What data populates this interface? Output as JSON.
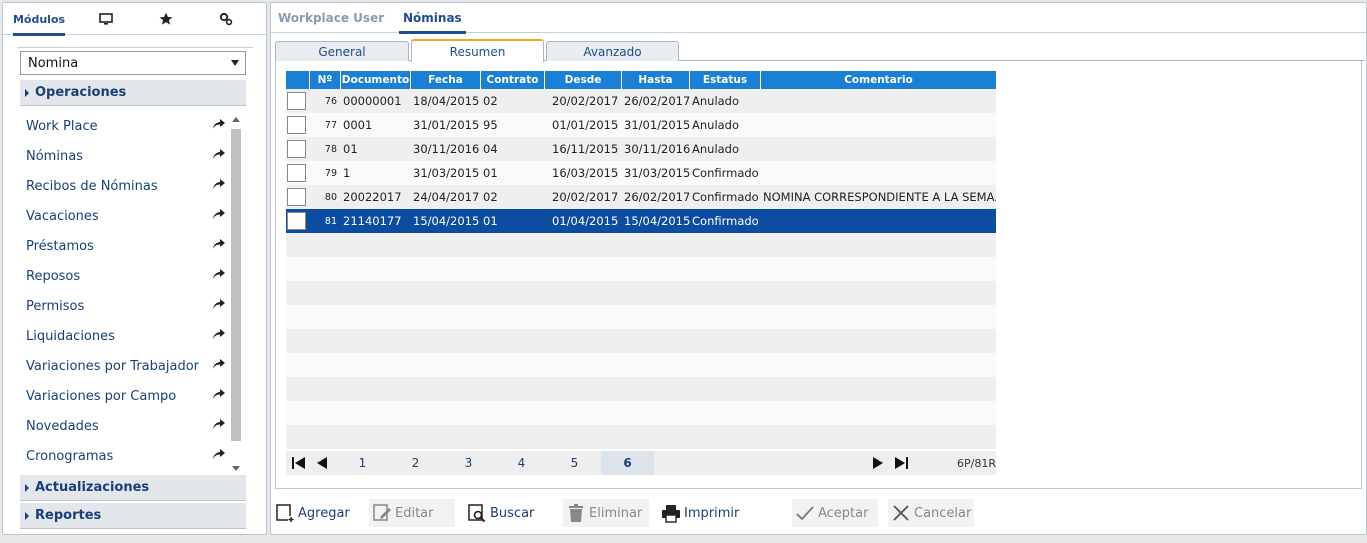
{
  "left_tabs": [
    {
      "label": "Módulos",
      "icon": null
    },
    {
      "label": "",
      "icon": "monitor-icon"
    },
    {
      "label": "",
      "icon": "star-icon"
    },
    {
      "label": "",
      "icon": "gear-settings-icon"
    }
  ],
  "module_select": {
    "value": "Nomina"
  },
  "sections": {
    "operaciones": "Operaciones",
    "actualizaciones": "Actualizaciones",
    "reportes": "Reportes"
  },
  "menu_items": [
    "Work Place",
    "Nóminas",
    "Recibos de Nóminas",
    "Vacaciones",
    "Préstamos",
    "Reposos",
    "Permisos",
    "Liquidaciones",
    "Variaciones por Trabajador",
    "Variaciones por Campo",
    "Novedades",
    "Cronogramas"
  ],
  "top_tabs": [
    "Workplace User",
    "Nóminas"
  ],
  "sub_tabs": [
    "General",
    "Resumen",
    "Avanzado"
  ],
  "grid": {
    "headers": [
      "Nº",
      "Documento",
      "Fecha",
      "Contrato",
      "Desde",
      "Hasta",
      "Estatus",
      "Comentario"
    ],
    "rows": [
      {
        "n": "76",
        "doc": "00000001",
        "fecha": "18/04/2015",
        "contrato": "02",
        "desde": "20/02/2017",
        "hasta": "26/02/2017",
        "estatus": "Anulado",
        "comentario": ""
      },
      {
        "n": "77",
        "doc": "0001",
        "fecha": "31/01/2015",
        "contrato": "95",
        "desde": "01/01/2015",
        "hasta": "31/01/2015",
        "estatus": "Anulado",
        "comentario": ""
      },
      {
        "n": "78",
        "doc": "01",
        "fecha": "30/11/2016",
        "contrato": "04",
        "desde": "16/11/2015",
        "hasta": "30/11/2016",
        "estatus": "Anulado",
        "comentario": ""
      },
      {
        "n": "79",
        "doc": "1",
        "fecha": "31/03/2015",
        "contrato": "01",
        "desde": "16/03/2015",
        "hasta": "31/03/2015",
        "estatus": "Confirmado",
        "comentario": ""
      },
      {
        "n": "80",
        "doc": "20022017",
        "fecha": "24/04/2017",
        "contrato": "02",
        "desde": "20/02/2017",
        "hasta": "26/02/2017",
        "estatus": "Confirmado",
        "comentario": "NOMINA CORRESPONDIENTE A LA SEMA..."
      },
      {
        "n": "81",
        "doc": "21140177",
        "fecha": "15/04/2015",
        "contrato": "01",
        "desde": "01/04/2015",
        "hasta": "15/04/2015",
        "estatus": "Confirmado",
        "comentario": ""
      }
    ],
    "selected_row": 5
  },
  "pager": {
    "pages": [
      "1",
      "2",
      "3",
      "4",
      "5",
      "6"
    ],
    "active_page": "6",
    "info": "6P/81R"
  },
  "toolbar": {
    "agregar": "Agregar",
    "editar": "Editar",
    "buscar": "Buscar",
    "eliminar": "Eliminar",
    "imprimir": "Imprimir",
    "aceptar": "Aceptar",
    "cancelar": "Cancelar"
  },
  "colors": {
    "accent": "#1f4d8f",
    "grid_header": "#1c7fd6",
    "selected_row": "#0c4da1",
    "tab_highlight": "#f3a81d"
  }
}
